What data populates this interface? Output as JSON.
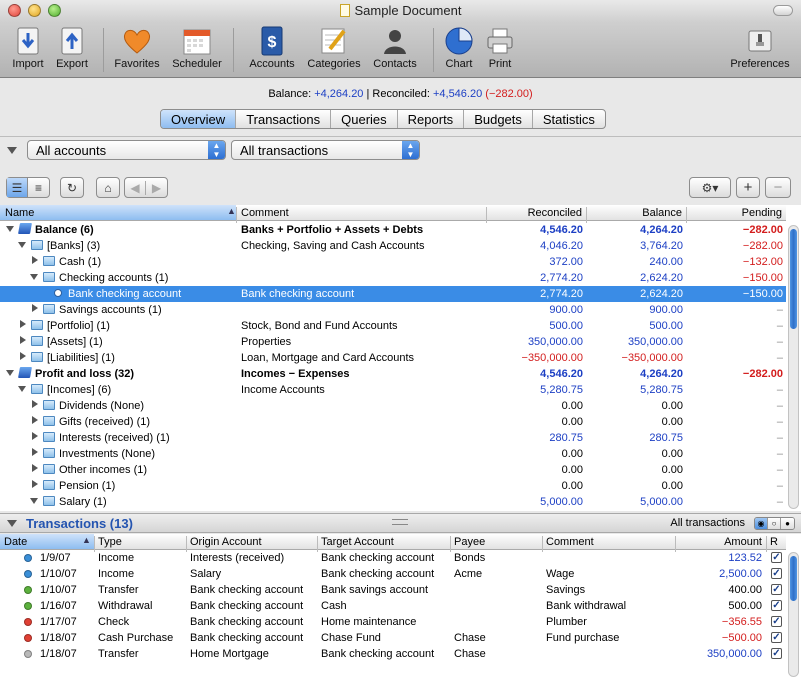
{
  "window": {
    "title": "Sample Document"
  },
  "toolbar": {
    "items": [
      {
        "label": "Import",
        "icon": "import-icon"
      },
      {
        "label": "Export",
        "icon": "export-icon"
      },
      {
        "label": "Favorites",
        "icon": "heart-icon"
      },
      {
        "label": "Scheduler",
        "icon": "calendar-icon"
      },
      {
        "label": "Accounts",
        "icon": "accounts-book-icon"
      },
      {
        "label": "Categories",
        "icon": "categories-icon"
      },
      {
        "label": "Contacts",
        "icon": "person-icon"
      },
      {
        "label": "Chart",
        "icon": "pie-chart-icon"
      },
      {
        "label": "Print",
        "icon": "printer-icon"
      },
      {
        "label": "Preferences",
        "icon": "preferences-icon"
      }
    ]
  },
  "balance_bar": {
    "balance_label": "Balance:",
    "balance_value": "+4,264.20",
    "separator": "|",
    "reconciled_label": "Reconciled:",
    "reconciled_value": "+4,546.20",
    "pending_value": "(−282.00)"
  },
  "tabs": [
    {
      "label": "Overview",
      "active": true
    },
    {
      "label": "Transactions",
      "active": false
    },
    {
      "label": "Queries",
      "active": false
    },
    {
      "label": "Reports",
      "active": false
    },
    {
      "label": "Budgets",
      "active": false
    },
    {
      "label": "Statistics",
      "active": false
    }
  ],
  "filters": {
    "accounts": "All accounts",
    "transactions": "All transactions"
  },
  "accounts_table": {
    "columns": [
      "Name",
      "Comment",
      "Reconciled",
      "Balance",
      "Pending"
    ],
    "rows": [
      {
        "level": 0,
        "tri": "open",
        "icon": "book",
        "bold": true,
        "name": "Balance (6)",
        "comment": "Banks + Portfolio + Assets + Debts",
        "reconciled": "4,546.20",
        "balance": "4,264.20",
        "pending": "−282.00",
        "rc": "blue",
        "bc": "blue",
        "pc": "red"
      },
      {
        "level": 1,
        "tri": "open",
        "icon": "folder",
        "name": "[Banks] (3)",
        "comment": "Checking, Saving and Cash Accounts",
        "reconciled": "4,046.20",
        "balance": "3,764.20",
        "pending": "−282.00",
        "rc": "blue",
        "bc": "blue",
        "pc": "red"
      },
      {
        "level": 2,
        "tri": "closed",
        "icon": "folder",
        "name": "Cash (1)",
        "comment": "",
        "reconciled": "372.00",
        "balance": "240.00",
        "pending": "−132.00",
        "rc": "blue",
        "bc": "blue",
        "pc": "red"
      },
      {
        "level": 2,
        "tri": "open",
        "icon": "folder",
        "name": "Checking accounts (1)",
        "comment": "",
        "reconciled": "2,774.20",
        "balance": "2,624.20",
        "pending": "−150.00",
        "rc": "blue",
        "bc": "blue",
        "pc": "red"
      },
      {
        "level": 3,
        "tri": "none",
        "icon": "dot",
        "selected": true,
        "name": "Bank checking account",
        "comment": "Bank checking account",
        "reconciled": "2,774.20",
        "balance": "2,624.20",
        "pending": "−150.00",
        "rc": "blue",
        "bc": "blue",
        "pc": "red"
      },
      {
        "level": 2,
        "tri": "closed",
        "icon": "folder",
        "name": "Savings accounts (1)",
        "comment": "",
        "reconciled": "900.00",
        "balance": "900.00",
        "pending": "–",
        "rc": "blue",
        "bc": "blue",
        "pc": "gray"
      },
      {
        "level": 1,
        "tri": "closed",
        "icon": "folder",
        "name": "[Portfolio] (1)",
        "comment": "Stock, Bond and Fund Accounts",
        "reconciled": "500.00",
        "balance": "500.00",
        "pending": "–",
        "rc": "blue",
        "bc": "blue",
        "pc": "gray"
      },
      {
        "level": 1,
        "tri": "closed",
        "icon": "folder",
        "name": "[Assets] (1)",
        "comment": "Properties",
        "reconciled": "350,000.00",
        "balance": "350,000.00",
        "pending": "–",
        "rc": "blue",
        "bc": "blue",
        "pc": "gray"
      },
      {
        "level": 1,
        "tri": "closed",
        "icon": "folder",
        "name": "[Liabilities] (1)",
        "comment": "Loan, Mortgage and Card Accounts",
        "reconciled": "−350,000.00",
        "balance": "−350,000.00",
        "pending": "–",
        "rc": "red",
        "bc": "red",
        "pc": "gray"
      },
      {
        "level": 0,
        "tri": "open",
        "icon": "book",
        "bold": true,
        "name": "Profit and loss (32)",
        "comment": "Incomes − Expenses",
        "reconciled": "4,546.20",
        "balance": "4,264.20",
        "pending": "−282.00",
        "rc": "blue",
        "bc": "blue",
        "pc": "red"
      },
      {
        "level": 1,
        "tri": "open",
        "icon": "folder",
        "name": "[Incomes] (6)",
        "comment": "Income Accounts",
        "reconciled": "5,280.75",
        "balance": "5,280.75",
        "pending": "–",
        "rc": "blue",
        "bc": "blue",
        "pc": "gray"
      },
      {
        "level": 2,
        "tri": "closed",
        "icon": "folder",
        "name": "Dividends (None)",
        "comment": "",
        "reconciled": "0.00",
        "balance": "0.00",
        "pending": "–",
        "rc": "",
        "bc": "",
        "pc": "gray"
      },
      {
        "level": 2,
        "tri": "closed",
        "icon": "folder",
        "name": "Gifts (received) (1)",
        "comment": "",
        "reconciled": "0.00",
        "balance": "0.00",
        "pending": "–",
        "rc": "",
        "bc": "",
        "pc": "gray"
      },
      {
        "level": 2,
        "tri": "closed",
        "icon": "folder",
        "name": "Interests (received) (1)",
        "comment": "",
        "reconciled": "280.75",
        "balance": "280.75",
        "pending": "–",
        "rc": "blue",
        "bc": "blue",
        "pc": "gray"
      },
      {
        "level": 2,
        "tri": "closed",
        "icon": "folder",
        "name": "Investments (None)",
        "comment": "",
        "reconciled": "0.00",
        "balance": "0.00",
        "pending": "–",
        "rc": "",
        "bc": "",
        "pc": "gray"
      },
      {
        "level": 2,
        "tri": "closed",
        "icon": "folder",
        "name": "Other incomes (1)",
        "comment": "",
        "reconciled": "0.00",
        "balance": "0.00",
        "pending": "–",
        "rc": "",
        "bc": "",
        "pc": "gray"
      },
      {
        "level": 2,
        "tri": "closed",
        "icon": "folder",
        "name": "Pension (1)",
        "comment": "",
        "reconciled": "0.00",
        "balance": "0.00",
        "pending": "–",
        "rc": "",
        "bc": "",
        "pc": "gray"
      },
      {
        "level": 2,
        "tri": "open",
        "icon": "folder",
        "name": "Salary (1)",
        "comment": "",
        "reconciled": "5,000.00",
        "balance": "5,000.00",
        "pending": "–",
        "rc": "blue",
        "bc": "blue",
        "pc": "gray"
      }
    ]
  },
  "transactions_panel": {
    "title": "Transactions (13)",
    "filter_label": "All transactions",
    "columns": [
      "Date",
      "Type",
      "Origin Account",
      "Target Account",
      "Payee",
      "Comment",
      "Amount",
      "R"
    ],
    "rows": [
      {
        "dot": "#3a8fd8",
        "date": "1/9/07",
        "type": "Income",
        "origin": "Interests (received)",
        "target": "Bank checking account",
        "payee": "Bonds",
        "comment": "",
        "amount": "123.52",
        "ac": "blue"
      },
      {
        "dot": "#3a8fd8",
        "date": "1/10/07",
        "type": "Income",
        "origin": "Salary",
        "target": "Bank checking account",
        "payee": "Acme",
        "comment": "Wage",
        "amount": "2,500.00",
        "ac": "blue"
      },
      {
        "dot": "#5cb13d",
        "date": "1/10/07",
        "type": "Transfer",
        "origin": "Bank checking account",
        "target": "Bank savings account",
        "payee": "",
        "comment": "Savings",
        "amount": "400.00",
        "ac": ""
      },
      {
        "dot": "#5cb13d",
        "date": "1/16/07",
        "type": "Withdrawal",
        "origin": "Bank checking account",
        "target": "Cash",
        "payee": "",
        "comment": "Bank withdrawal",
        "amount": "500.00",
        "ac": ""
      },
      {
        "dot": "#e04034",
        "date": "1/17/07",
        "type": "Check",
        "origin": "Bank checking account",
        "target": "Home maintenance",
        "payee": "",
        "comment": "Plumber",
        "amount": "−356.55",
        "ac": "red"
      },
      {
        "dot": "#e04034",
        "date": "1/18/07",
        "type": "Cash Purchase",
        "origin": "Bank checking account",
        "target": "Chase Fund",
        "payee": "Chase",
        "comment": "Fund purchase",
        "amount": "−500.00",
        "ac": "red"
      },
      {
        "dot": "#b9b9b9",
        "date": "1/18/07",
        "type": "Transfer",
        "origin": "Home Mortgage",
        "target": "Bank checking account",
        "payee": "Chase",
        "comment": "",
        "amount": "350,000.00",
        "ac": "blue"
      }
    ]
  }
}
